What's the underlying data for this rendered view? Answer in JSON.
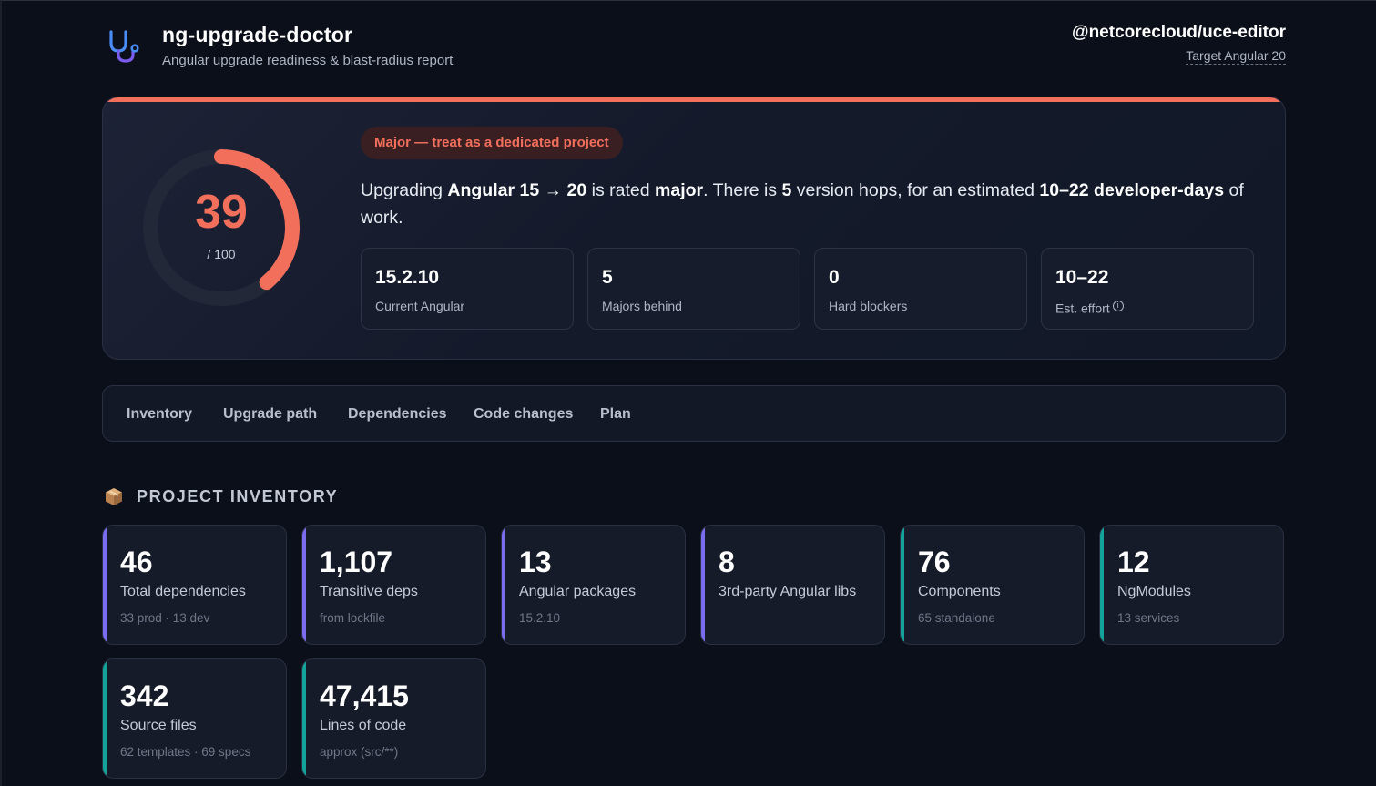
{
  "header": {
    "app_title": "ng-upgrade-doctor",
    "app_subtitle": "Angular upgrade readiness & blast-radius report",
    "project_name": "@netcorecloud/uce-editor",
    "target_label": "Target Angular 20"
  },
  "hero": {
    "accent_color": "#f26f5c",
    "score": "39",
    "score_max": "/ 100",
    "score_fraction": 0.39,
    "badge": "Major — treat as a dedicated project",
    "sentence": {
      "p1": "Upgrading ",
      "from_to": "Angular 15 → 20",
      "p2": " is rated ",
      "rating": "major",
      "p3": ". There is ",
      "hops": "5",
      "p4": " version hops, for an estimated ",
      "effort": "10–22 developer-days",
      "p5": " of work."
    },
    "stats": [
      {
        "value": "15.2.10",
        "label": "Current Angular"
      },
      {
        "value": "5",
        "label": "Majors behind"
      },
      {
        "value": "0",
        "label": "Hard blockers"
      },
      {
        "value": "10–22",
        "label": "Est. effort",
        "icon": "info-icon"
      }
    ]
  },
  "tabs": [
    "Inventory",
    "Upgrade path",
    "Dependencies",
    "Code changes",
    "Plan"
  ],
  "inventory": {
    "title": "PROJECT INVENTORY",
    "icon": "package-icon",
    "accent_purple": "#7c6cf0",
    "accent_teal": "#14a39a",
    "cards": [
      {
        "value": "46",
        "label": "Total dependencies",
        "sub": "33 prod · 13 dev",
        "accent": "purple"
      },
      {
        "value": "1,107",
        "label": "Transitive deps",
        "sub": "from lockfile",
        "accent": "purple"
      },
      {
        "value": "13",
        "label": "Angular packages",
        "sub": "15.2.10",
        "accent": "purple"
      },
      {
        "value": "8",
        "label": "3rd-party Angular libs",
        "sub": "",
        "accent": "purple"
      },
      {
        "value": "76",
        "label": "Components",
        "sub": "65 standalone",
        "accent": "teal"
      },
      {
        "value": "12",
        "label": "NgModules",
        "sub": "13 services",
        "accent": "teal"
      },
      {
        "value": "342",
        "label": "Source files",
        "sub": "62 templates · 69 specs",
        "accent": "teal"
      },
      {
        "value": "47,415",
        "label": "Lines of code",
        "sub": "approx (src/**)",
        "accent": "teal"
      }
    ]
  }
}
